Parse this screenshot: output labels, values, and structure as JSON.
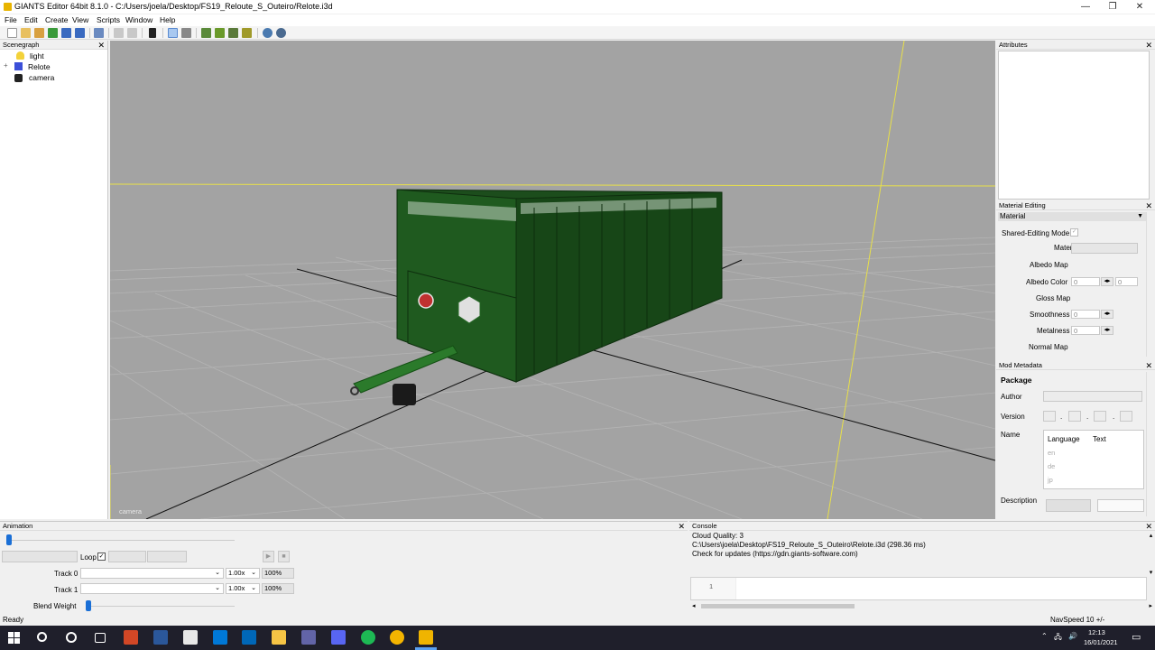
{
  "window": {
    "title": "GIANTS Editor 64bit 8.1.0 - C:/Users/joela/Desktop/FS19_Reloute_S_Outeiro/Relote.i3d",
    "minimize": "—",
    "restore": "❐",
    "close": "✕"
  },
  "menu": [
    "File",
    "Edit",
    "Create",
    "View",
    "Scripts",
    "Window",
    "Help"
  ],
  "scenegraph": {
    "title": "Scenegraph",
    "close": "✕",
    "items": [
      {
        "label": "light",
        "icon": "lightbulb-icon"
      },
      {
        "label": "Relote",
        "icon": "shape-icon",
        "expander": "+"
      },
      {
        "label": "camera",
        "icon": "camera-icon"
      }
    ]
  },
  "viewport": {
    "camera_label": "camera",
    "colors": {
      "background": "#a3a3a3",
      "trailer": "#1c4d1c",
      "drawbar": "#2b7a2b",
      "axis_yellow": "#e8e04a"
    }
  },
  "attributes": {
    "title": "Attributes",
    "close": "✕"
  },
  "material_editing": {
    "title": "Material Editing",
    "close": "✕",
    "section": "Material",
    "shared_editing_mode": "Shared-Editing Mode",
    "shared_check": "✓",
    "labels": {
      "material": "Material",
      "albedo_map": "Albedo Map",
      "albedo_color": "Albedo Color",
      "gloss_map": "Gloss Map",
      "smoothness": "Smoothness",
      "metalness": "Metalness",
      "normal_map": "Normal Map"
    },
    "values": {
      "albedo_r": "0",
      "albedo_g": "0",
      "smoothness": "0",
      "metalness": "0"
    },
    "spin": "◂▸"
  },
  "mod_metadata": {
    "title": "Mod Metadata",
    "close": "✕",
    "package": "Package",
    "author": "Author",
    "version": "Version",
    "version_dot": ".",
    "name": "Name",
    "columns": [
      "Language",
      "Text"
    ],
    "languages": [
      "en",
      "de",
      "jp"
    ],
    "description": "Description"
  },
  "animation": {
    "title": "Animation",
    "close": "✕",
    "loop": "Loop",
    "loop_check": "✓",
    "tracks": [
      {
        "label": "Track 0",
        "speed": "1.00x",
        "weight": "100%"
      },
      {
        "label": "Track 1",
        "speed": "1.00x",
        "weight": "100%"
      }
    ],
    "blend_weight": "Blend Weight",
    "play": "▶",
    "stop": "■",
    "caret": "⌄"
  },
  "console": {
    "title": "Console",
    "close": "✕",
    "lines": [
      " Cloud Quality: 3",
      "C:\\Users\\joela\\Desktop\\FS19_Reloute_S_Outeiro\\Relote.i3d (298.36 ms)",
      "Check for updates (https://gdn.giants-software.com)"
    ],
    "line_number": "1",
    "scroll_up": "▴",
    "scroll_down": "▾",
    "scroll_left": "◂",
    "scroll_right": "▸"
  },
  "status": {
    "left": "Ready",
    "right": "NavSpeed 10 +/-"
  },
  "taskbar": {
    "time": "12:13",
    "date": "16/01/2021",
    "apps": [
      {
        "name": "windows-start-icon",
        "color": "#ffffff"
      },
      {
        "name": "search-icon",
        "color": "#ffffff"
      },
      {
        "name": "cortana-icon",
        "color": "#ffffff"
      },
      {
        "name": "task-view-icon",
        "color": "#ffffff"
      },
      {
        "name": "powerpoint-icon",
        "color": "#d24726"
      },
      {
        "name": "word-icon",
        "color": "#2b579a"
      },
      {
        "name": "store-icon",
        "color": "#ffffff"
      },
      {
        "name": "mail-icon",
        "color": "#0078d7"
      },
      {
        "name": "ms-store-icon",
        "color": "#0078d7"
      },
      {
        "name": "file-explorer-icon",
        "color": "#f6c445"
      },
      {
        "name": "teams-icon",
        "color": "#6264a7"
      },
      {
        "name": "discord-icon",
        "color": "#5865f2"
      },
      {
        "name": "spotify-icon",
        "color": "#1db954"
      },
      {
        "name": "chrome-icon",
        "color": "#f4b400"
      },
      {
        "name": "giants-editor-icon",
        "color": "#f0b400"
      }
    ],
    "tray": {
      "chevron": "⌃",
      "network": "🖧",
      "volume": "🔊",
      "notification": "▭"
    }
  }
}
